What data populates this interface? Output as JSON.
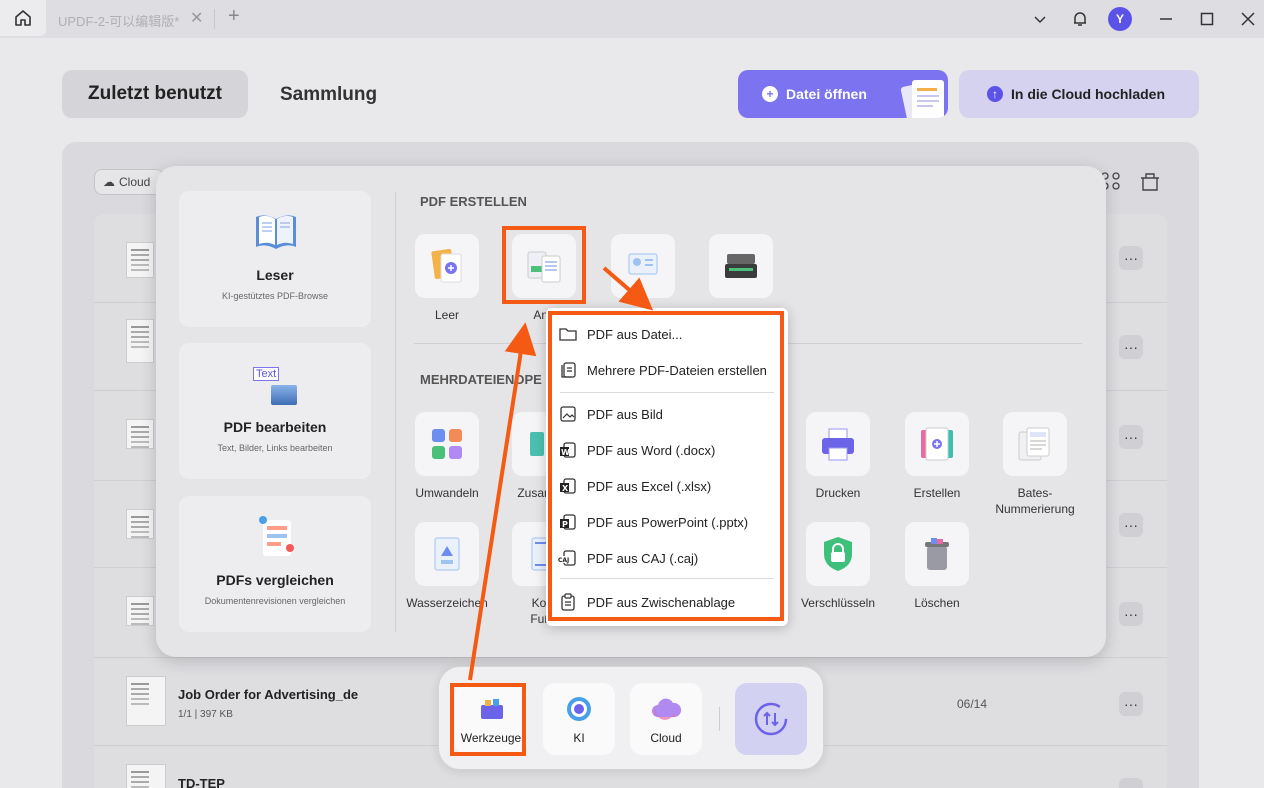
{
  "titlebar": {
    "tab_title": "UPDF-2-可以编辑版*",
    "avatar_initial": "Y"
  },
  "header": {
    "tab_recent": "Zuletzt benutzt",
    "tab_collection": "Sammlung",
    "open_button": "Datei öffnen",
    "cloud_button": "In die Cloud hochladen"
  },
  "filebar": {
    "cloud_label": "Cloud"
  },
  "files": [
    {
      "name": "Job Order for Advertising_de",
      "meta": "1/1 | 397 KB",
      "date": "06/14"
    },
    {
      "name": "TD-TEP",
      "meta": "",
      "date": ""
    }
  ],
  "cards": [
    {
      "title": "Leser",
      "subtitle": "KI-gestütztes PDF-Browse"
    },
    {
      "title": "PDF bearbeiten",
      "subtitle": "Text, Bilder, Links bearbeiten",
      "icon_text": "Text"
    },
    {
      "title": "PDFs vergleichen",
      "subtitle": "Dokumentenrevisionen vergleichen"
    }
  ],
  "create_section": {
    "heading": "PDF ERSTELLEN",
    "tools": [
      {
        "label": "Leer"
      },
      {
        "label": "And"
      }
    ]
  },
  "multi_section": {
    "heading": "MEHRDATEIENOPE",
    "tools": [
      {
        "label": "Umwandeln"
      },
      {
        "label": "Zusamme"
      },
      {
        "label": "Drucken"
      },
      {
        "label": "Erstellen"
      },
      {
        "label": "Bates-Nummerierung"
      },
      {
        "label": "Wasserzeichen"
      },
      {
        "label": "Kopf\nFußz"
      },
      {
        "label": "Verschlüsseln"
      },
      {
        "label": "Löschen"
      }
    ]
  },
  "menu": {
    "items": [
      {
        "label": "PDF aus Datei...",
        "icon": "folder-icon"
      },
      {
        "label": "Mehrere PDF-Dateien erstellen",
        "icon": "multi-doc-icon"
      },
      {
        "label": "PDF aus Bild",
        "icon": "image-icon"
      },
      {
        "label": "PDF aus Word (.docx)",
        "icon": "word-icon"
      },
      {
        "label": "PDF aus Excel (.xlsx)",
        "icon": "excel-icon"
      },
      {
        "label": "PDF aus PowerPoint (.pptx)",
        "icon": "powerpoint-icon"
      },
      {
        "label": "PDF aus CAJ (.caj)",
        "icon": "caj-icon"
      },
      {
        "label": "PDF aus Zwischenablage",
        "icon": "clipboard-icon"
      }
    ]
  },
  "dock": {
    "items": [
      {
        "label": "Werkzeuge"
      },
      {
        "label": "KI"
      },
      {
        "label": "Cloud"
      }
    ]
  },
  "colors": {
    "accent": "#7b73f0",
    "annotation": "#f55a14"
  }
}
